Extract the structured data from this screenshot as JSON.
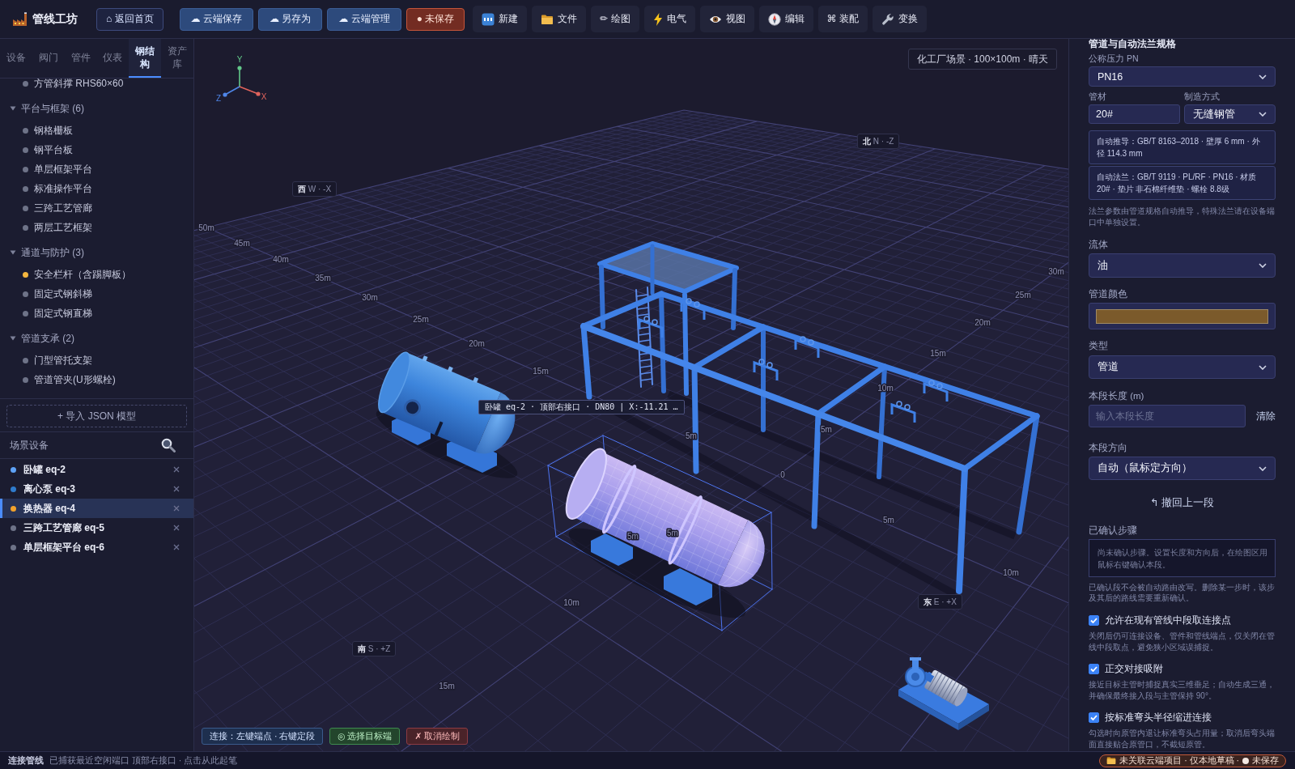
{
  "topbar": {
    "logo": "管线工坊",
    "buttons": [
      {
        "kind": "outline",
        "label": "⌂ 返回首页"
      },
      {
        "kind": "cloud",
        "label": "☁ 云端保存"
      },
      {
        "kind": "cloud",
        "label": "☁ 另存为"
      },
      {
        "kind": "cloud",
        "label": "☁ 云端管理"
      },
      {
        "kind": "unsaved",
        "label": "● 未保存"
      }
    ],
    "menus": [
      {
        "label": "新建"
      },
      {
        "label": "文件"
      },
      {
        "label": "✏ 绘图"
      },
      {
        "label": "电气"
      },
      {
        "label": "视图"
      },
      {
        "label": "编辑"
      },
      {
        "label": "⌘ 装配"
      },
      {
        "label": "变换"
      }
    ]
  },
  "sidebar": {
    "tabs": [
      {
        "label": "设备",
        "selected": false
      },
      {
        "label": "阀门",
        "selected": false
      },
      {
        "label": "管件",
        "selected": false
      },
      {
        "label": "仪表",
        "selected": false
      },
      {
        "label": "钢结构",
        "selected": true
      },
      {
        "label": "资产库",
        "selected": false
      }
    ],
    "tree": [
      {
        "kind": "item",
        "label": "方管斜撑 RHS60×60",
        "color": "#6e7388"
      },
      {
        "kind": "group",
        "label": "平台与框架 (6)",
        "expanded": true,
        "children": [
          {
            "label": "钢格栅板",
            "color": "#6e7388"
          },
          {
            "label": "钢平台板",
            "color": "#6e7388"
          },
          {
            "label": "单层框架平台",
            "color": "#6e7388"
          },
          {
            "label": "标准操作平台",
            "color": "#6e7388"
          },
          {
            "label": "三跨工艺管廊",
            "color": "#6e7388"
          },
          {
            "label": "两层工艺框架",
            "color": "#6e7388"
          }
        ]
      },
      {
        "kind": "group",
        "label": "通道与防护 (3)",
        "expanded": true,
        "children": [
          {
            "label": "安全栏杆（含踢脚板）",
            "color": "#f4b63f"
          },
          {
            "label": "固定式钢斜梯",
            "color": "#6e7388"
          },
          {
            "label": "固定式钢直梯",
            "color": "#6e7388"
          }
        ]
      },
      {
        "kind": "group",
        "label": "管道支承 (2)",
        "expanded": true,
        "children": [
          {
            "label": "门型管托支架",
            "color": "#6e7388"
          },
          {
            "label": "管道管夹(U形螺栓)",
            "color": "#6e7388"
          }
        ]
      }
    ],
    "import_button": "+ 导入 JSON 模型",
    "scene": {
      "title": "场景设备",
      "items": [
        {
          "label": "卧罐 eq-2",
          "color": "#5ea2f6",
          "selected": false
        },
        {
          "label": "离心泵 eq-3",
          "color": "#2f7bcc",
          "selected": false
        },
        {
          "label": "换热器 eq-4",
          "color": "#f2a22c",
          "selected": true
        },
        {
          "label": "三跨工艺管廊 eq-5",
          "color": "#6e7388",
          "selected": false
        },
        {
          "label": "单层框架平台 eq-6",
          "color": "#6e7388",
          "selected": false
        }
      ]
    }
  },
  "viewport": {
    "axes": [
      {
        "label": "Y",
        "color": "#62c98a"
      },
      {
        "label": "Z",
        "color": "#4f86e8"
      },
      {
        "label": "X",
        "color": "#e0635c"
      }
    ],
    "scene_label": "化工厂场景 · 100×100m · 晴天",
    "compass": [
      "**西** W · -X",
      "**北** N · -Z",
      "**东** E · +X",
      "**南** S · +Z"
    ],
    "distance_labels": [
      "50m",
      "45m",
      "40m",
      "35m",
      "30m",
      "25m",
      "20m",
      "15m",
      "30m",
      "25m",
      "20m",
      "15m",
      "10m",
      "5m",
      "5m",
      "0",
      "5m",
      "5m",
      "5m",
      "10m",
      "10m",
      "15m"
    ],
    "tooltip": "卧罐 eq-2 · 顶部右接口 · DN80 | X:-11.21 …",
    "hint": "连接：左键端点 · 右键定段",
    "actions": [
      {
        "kind": "confirm",
        "label": "◎ 选择目标端"
      },
      {
        "kind": "cancel",
        "label": "✗ 取消绘制"
      }
    ]
  },
  "properties": {
    "title": "管道与自动法兰规格",
    "pressure": {
      "label": "公称压力 PN",
      "value": "PN16"
    },
    "material": {
      "label": "管材",
      "value": "20#"
    },
    "method": {
      "label": "制造方式",
      "value": "无缝钢管"
    },
    "derived": [
      "自动推导：GB/T 8163–2018 · 壁厚 6 mm · 外径 114.3 mm",
      "自动法兰：GB/T 9119 · PL/RF · PN16 · 材质 20# · 垫片 非石棉纤维垫 · 螺栓 8.8级"
    ],
    "flange_note": "法兰参数由管道规格自动推导，特殊法兰请在设备端口中单独设置。",
    "fluid": {
      "label": "流体",
      "value": "油"
    },
    "pipe_color": {
      "label": "管道颜色",
      "color": "#7b5a2b"
    },
    "type": {
      "label": "类型",
      "value": "管道"
    },
    "segment_length": {
      "label": "本段长度 (m)",
      "placeholder": "输入本段长度",
      "clear": "清除"
    },
    "direction": {
      "label": "本段方向",
      "value": "自动（鼠标定方向）"
    },
    "undo": "↰ 撤回上一段",
    "steps": {
      "label": "已确认步骤",
      "empty": "尚未确认步骤。设置长度和方向后，在绘图区用鼠标右键确认本段。",
      "note": "已确认段不会被自动路由改写。删除某一步时，该步及其后的路线需要重新确认。"
    },
    "options": [
      {
        "label": "允许在现有管线中段取连接点",
        "checked": true,
        "hint": "关闭后仍可连接设备、管件和管线端点，仅关闭在管线中段取点，避免狭小区域误捕捉。"
      },
      {
        "label": "正交对接吸附",
        "checked": true,
        "hint": "接近目标主管时捕捉真实三维垂足；自动生成三通，并确保最终接入段与主管保持 90°。"
      },
      {
        "label": "按标准弯头半径缩进连接",
        "checked": true,
        "hint": "勾选时向原管内退让标准弯头占用量；取消后弯头端面直接贴合原管口，不截短原管。"
      }
    ]
  },
  "status_bar": {
    "mode": "连接管线",
    "message": "已捕获最近空闲端口 顶部右接口 · 点击从此起笔",
    "project": {
      "text": "未关联云端项目 · 仅本地草稿 ·",
      "status": "未保存",
      "saved": false
    }
  }
}
